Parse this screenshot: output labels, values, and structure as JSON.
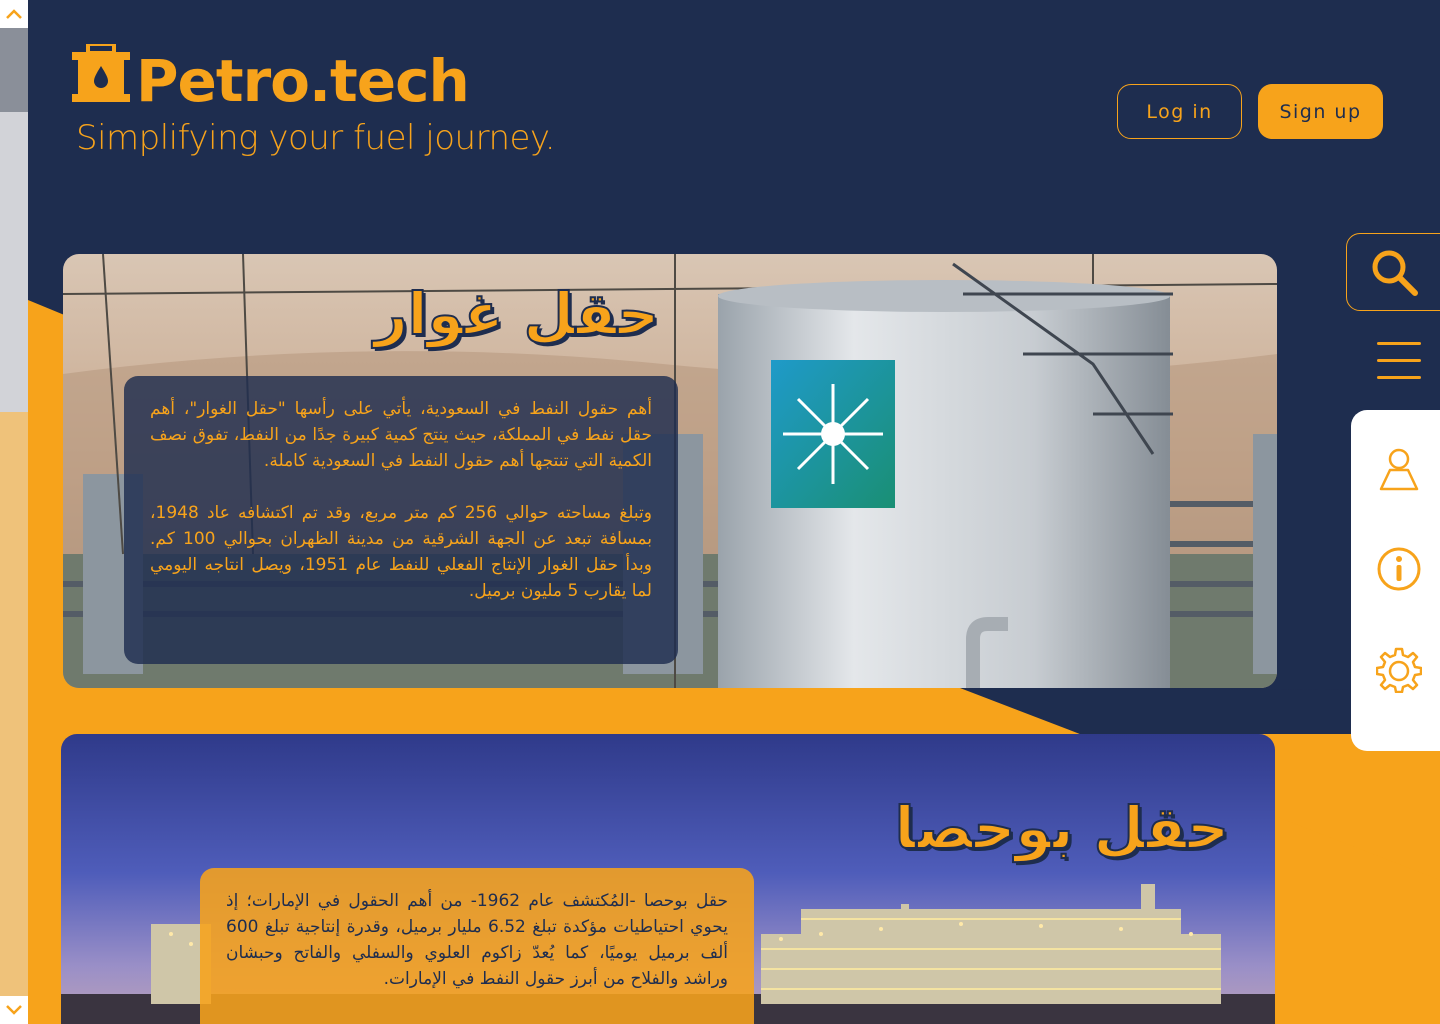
{
  "brand": {
    "name": "Petro.tech",
    "tagline": "Simplifying your fuel journey."
  },
  "auth": {
    "login_label": "Log in",
    "signup_label": "Sign up"
  },
  "colors": {
    "navy": "#1e2d4f",
    "orange": "#f7a31b",
    "white": "#ffffff"
  },
  "nav": {
    "icons": [
      "search-icon",
      "menu-icon",
      "user-icon",
      "info-icon",
      "settings-icon"
    ]
  },
  "cards": [
    {
      "title": "حقل غوار",
      "paragraphs": [
        "أهم حقول النفط في السعودية، يأتي على رأسها \"حقل الغوار\"، أهم حقل نفط في المملكة، حيث ينتج كمية كبيرة جدًا من النفط، تفوق نصف الكمية التي تنتجها أهم حقول النفط في السعودية كاملة.",
        "وتبلغ مساحته حوالي 256 كم متر مربع، وقد تم اكتشافه عاد 1948، بمسافة تبعد عن الجهة الشرقية من مدينة الظهران بحوالي 100 كم. وبدأ حقل الغوار الإنتاج الفعلي للنفط عام 1951، ويصل انتاجه اليومي لما يقارب 5 مليون برميل."
      ]
    },
    {
      "title": "حقل بوحصا",
      "paragraphs": [
        "حقل بوحصا -المُكتشف عام 1962- من أهم الحقول في الإمارات؛ إذ يحوي احتياطيات مؤكدة تبلغ 6.52 مليار برميل، وقدرة إنتاجية تبلغ 600 ألف برميل يوميًا، كما يُعدّ زاكوم العلوي والسفلي والفاتح وحبشان وراشد والفلاح من أبرز حقول النفط في الإمارات."
      ]
    }
  ]
}
